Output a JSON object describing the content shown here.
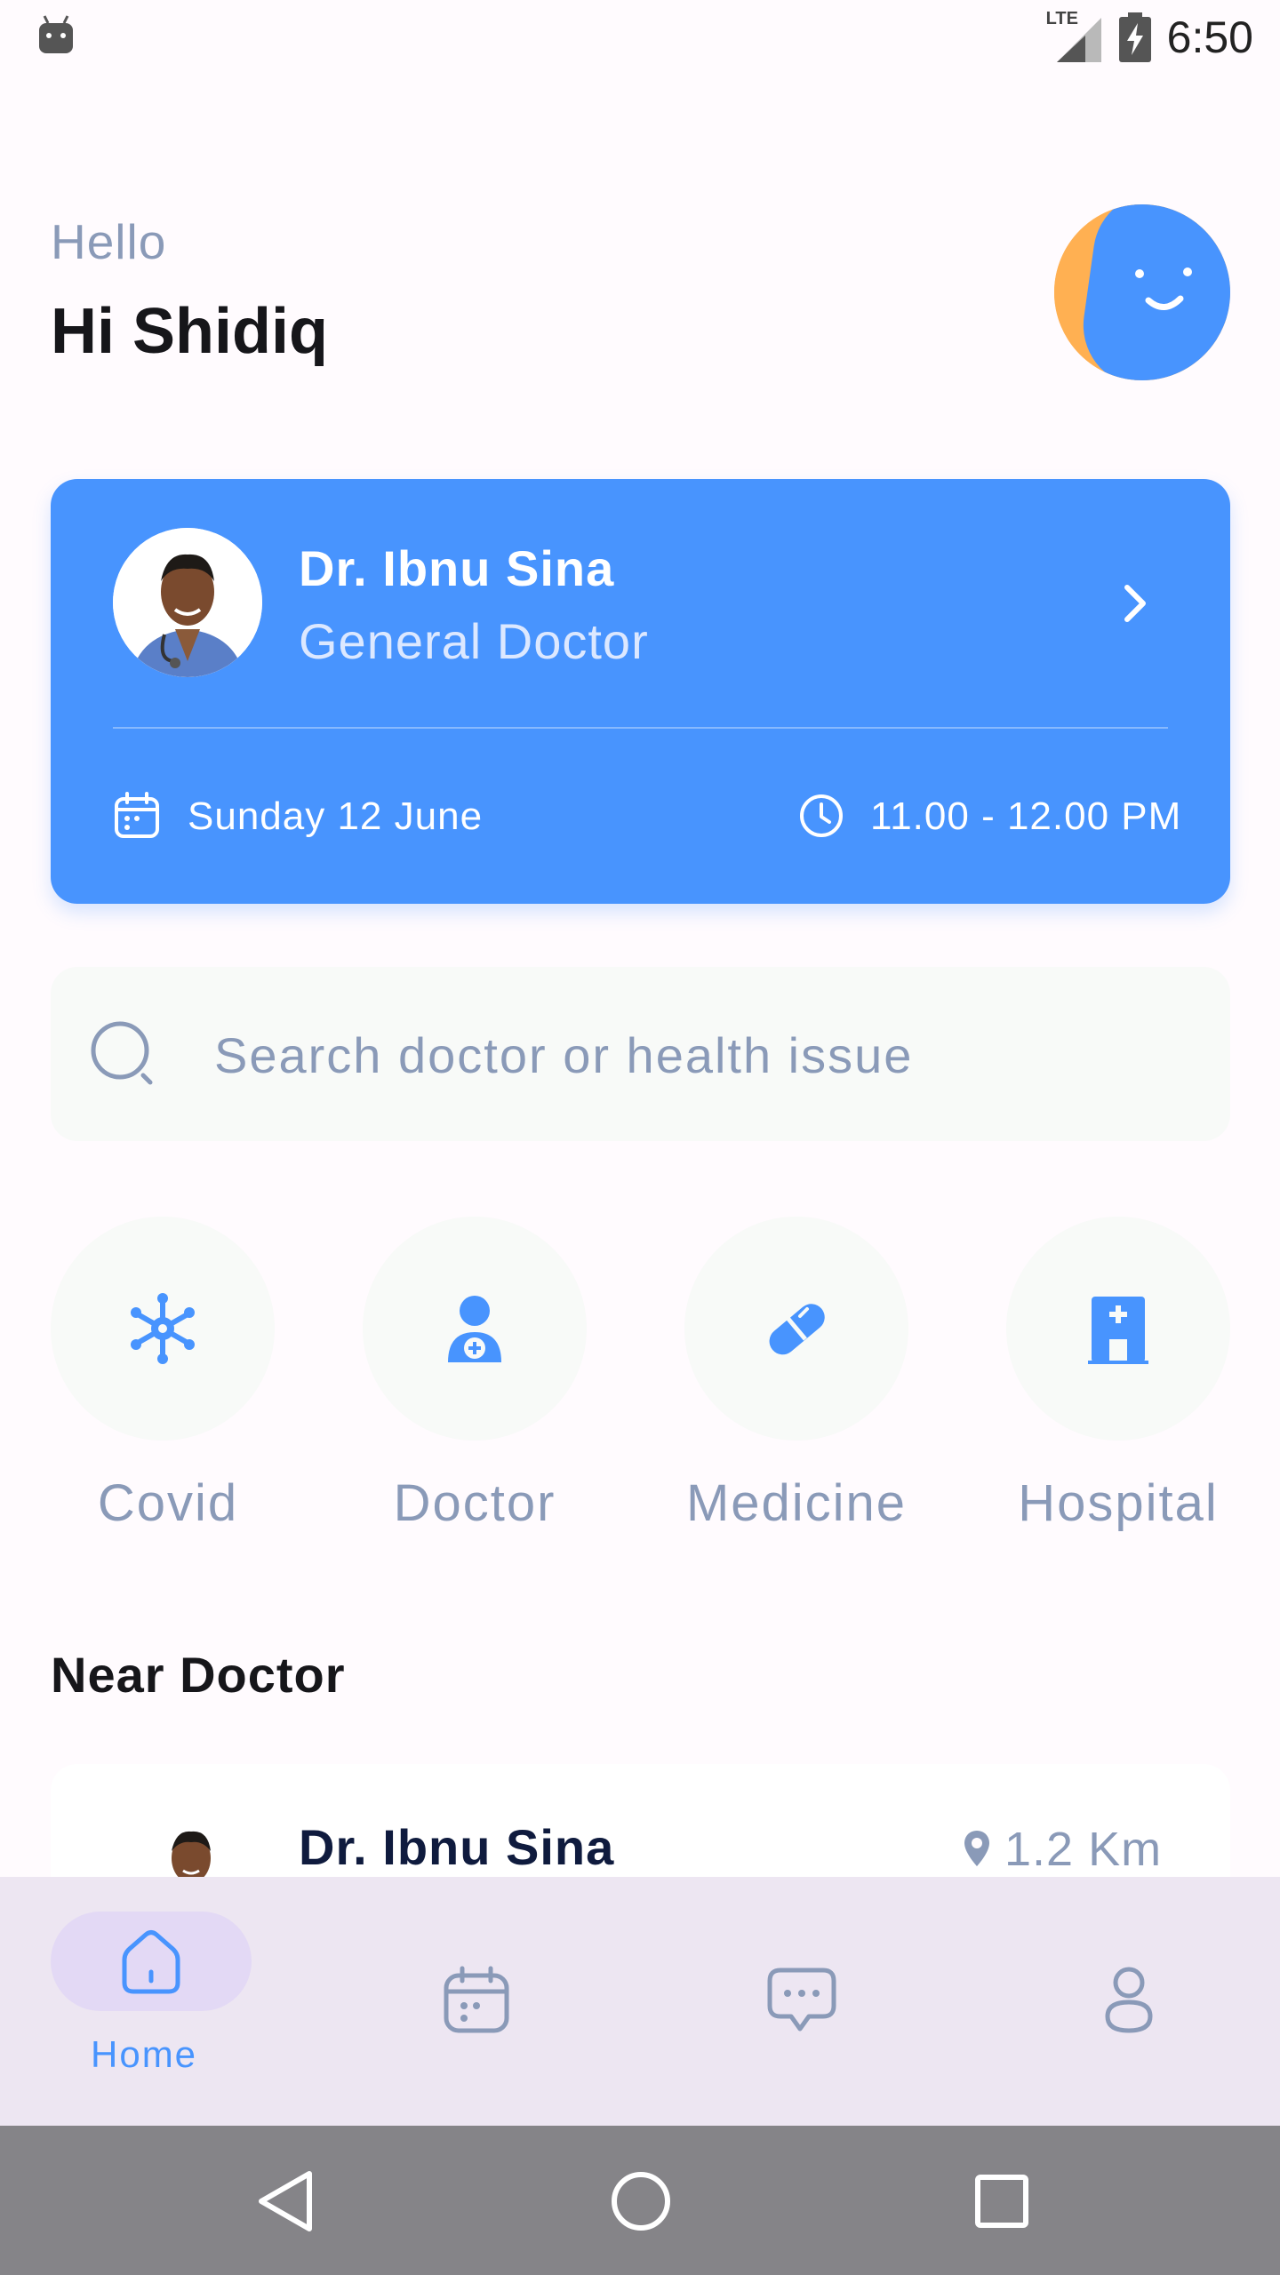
{
  "status_bar": {
    "network": "LTE",
    "time": "6:50"
  },
  "header": {
    "greeting": "Hello",
    "user_name": "Hi Shidiq"
  },
  "appointment": {
    "doctor_name": "Dr. Ibnu Sina",
    "doctor_role": "General Doctor",
    "date": "Sunday 12 June",
    "time": "11.00 - 12.00 PM"
  },
  "search": {
    "placeholder": "Search doctor or health issue"
  },
  "categories": [
    {
      "label": "Covid",
      "icon": "virus-icon"
    },
    {
      "label": "Doctor",
      "icon": "doctor-icon"
    },
    {
      "label": "Medicine",
      "icon": "pill-icon"
    },
    {
      "label": "Hospital",
      "icon": "hospital-icon"
    }
  ],
  "near_doctor": {
    "title": "Near Doctor",
    "doctor_name": "Dr. Ibnu Sina",
    "distance": "1.2 Km"
  },
  "bottom_nav": {
    "items": [
      {
        "label": "Home",
        "icon": "home-icon",
        "active": true
      },
      {
        "label": "",
        "icon": "calendar-icon",
        "active": false
      },
      {
        "label": "",
        "icon": "chat-icon",
        "active": false
      },
      {
        "label": "",
        "icon": "profile-icon",
        "active": false
      }
    ]
  },
  "colors": {
    "primary": "#4894fe",
    "muted_text": "#8a9ab8",
    "surface": "#f8faf8",
    "nav_background": "#ede6f2",
    "avatar_accent": "#ffb052"
  }
}
